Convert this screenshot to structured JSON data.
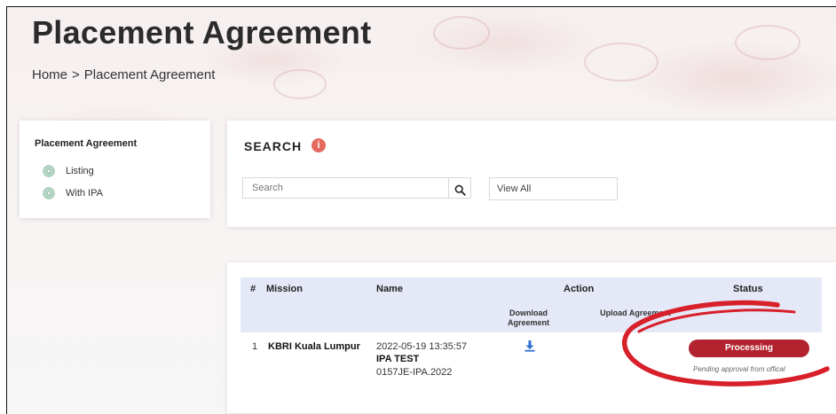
{
  "header": {
    "title": "Placement Agreement",
    "breadcrumb": {
      "home": "Home",
      "separator": ">",
      "current": "Placement Agreement"
    }
  },
  "sidebar": {
    "title": "Placement Agreement",
    "items": [
      {
        "label": "Listing",
        "icon": "fingerprint-icon"
      },
      {
        "label": "With IPA",
        "icon": "fingerprint-icon"
      }
    ]
  },
  "search": {
    "title": "SEARCH",
    "info_icon": "i",
    "placeholder": "Search",
    "value": "",
    "button_icon": "search-icon",
    "filter_value": "View All"
  },
  "table": {
    "headers": {
      "index": "#",
      "mission": "Mission",
      "name": "Name",
      "action": "Action",
      "download": "Download Agreement",
      "upload": "Upload Agreement",
      "status": "Status"
    },
    "rows": [
      {
        "index": "1",
        "mission": "KBRI Kuala Lumpur",
        "datetime": "2022-05-19 13:35:57",
        "name": "IPA TEST",
        "reference": "0157JE-IPA.2022",
        "download_icon": "download-icon",
        "status": "Processing",
        "status_note": "Pending approval from offical"
      }
    ]
  },
  "colors": {
    "status_badge": "#b3222f",
    "table_header": "#e5e8f7",
    "info_icon": "#e46a5f",
    "download_icon": "#2f6fd6",
    "annotation": "#d8202a"
  }
}
